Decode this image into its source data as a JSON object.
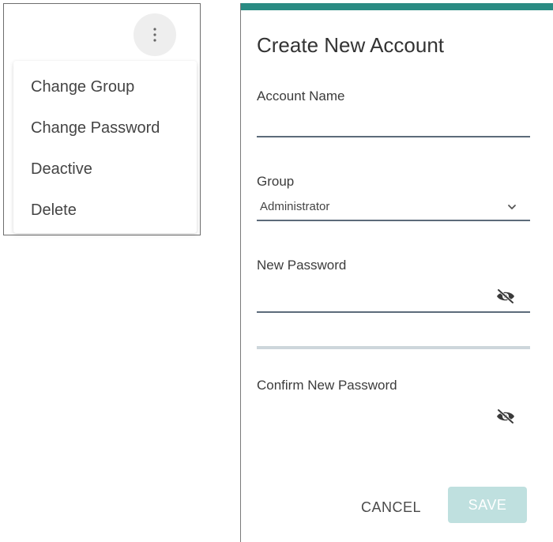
{
  "menu": {
    "items": [
      {
        "label": "Change Group"
      },
      {
        "label": "Change Password"
      },
      {
        "label": "Deactive"
      },
      {
        "label": "Delete"
      }
    ]
  },
  "dialog": {
    "title": "Create New Account",
    "account_name": {
      "label": "Account Name",
      "value": ""
    },
    "group": {
      "label": "Group",
      "value": "Administrator"
    },
    "new_password": {
      "label": "New Password",
      "value": ""
    },
    "confirm_password": {
      "label": "Confirm New Password",
      "value": ""
    },
    "cancel_label": "CANCEL",
    "save_label": "SAVE"
  },
  "colors": {
    "accent": "#2a8b83",
    "save_button_disabled": "#bfe0df",
    "input_underline": "#5c6b7a"
  },
  "icons": {
    "menu_trigger": "more-vertical-icon",
    "select_arrow": "chevron-down-icon",
    "password_toggle": "eye-off-icon"
  }
}
